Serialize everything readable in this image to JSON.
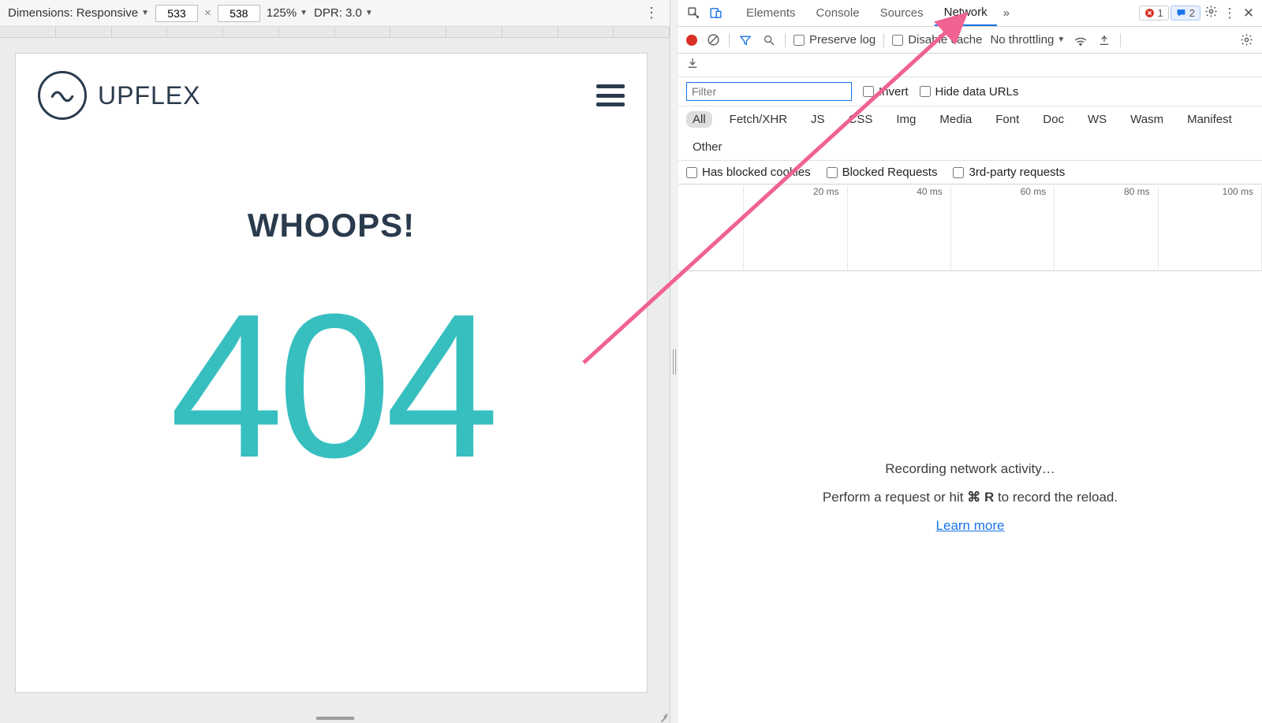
{
  "device_toolbar": {
    "dimensions_label": "Dimensions: Responsive",
    "width": "533",
    "height": "538",
    "zoom": "125%",
    "dpr": "DPR: 3.0"
  },
  "page": {
    "brand": "UPFLEX",
    "whoops": "WHOOPS!",
    "code": "404"
  },
  "devtools": {
    "tabs": [
      "Elements",
      "Console",
      "Sources",
      "Network"
    ],
    "active_tab": "Network",
    "error_count": "1",
    "message_count": "2"
  },
  "network": {
    "preserve_log": "Preserve log",
    "disable_cache": "Disable cache",
    "throttling": "No throttling",
    "filter_placeholder": "Filter",
    "invert": "Invert",
    "hide_data_urls": "Hide data URLs",
    "types": [
      "All",
      "Fetch/XHR",
      "JS",
      "CSS",
      "Img",
      "Media",
      "Font",
      "Doc",
      "WS",
      "Wasm",
      "Manifest",
      "Other"
    ],
    "active_type": "All",
    "has_blocked_cookies": "Has blocked cookies",
    "blocked_requests": "Blocked Requests",
    "third_party": "3rd-party requests",
    "timeline_marks": [
      "20 ms",
      "40 ms",
      "60 ms",
      "80 ms",
      "100 ms"
    ],
    "empty_title": "Recording network activity…",
    "empty_hint_pre": "Perform a request or hit ",
    "empty_hint_key": "⌘ R",
    "empty_hint_post": " to record the reload.",
    "learn_more": "Learn more"
  }
}
